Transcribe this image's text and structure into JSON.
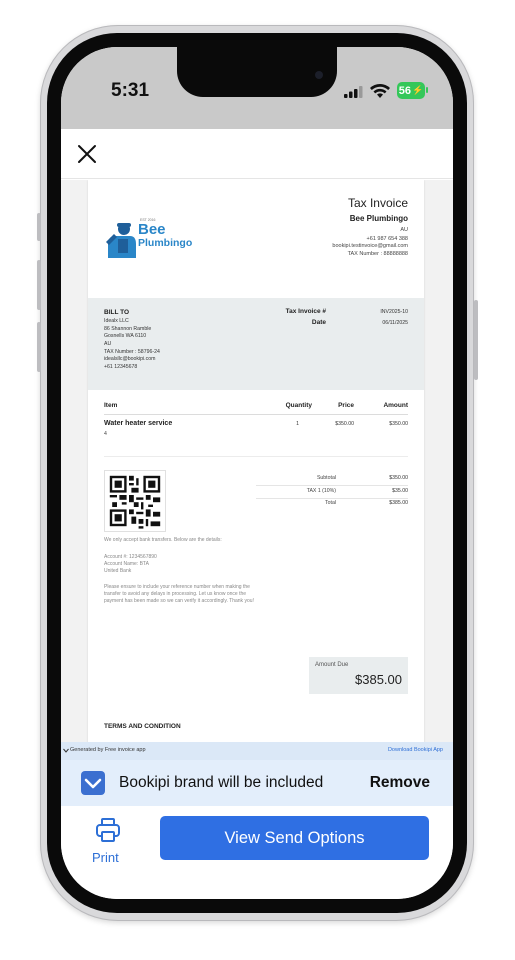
{
  "status_bar": {
    "time": "5:31",
    "battery": "56"
  },
  "invoice": {
    "title": "Tax Invoice",
    "company": "Bee Plumbingo",
    "country": "AU",
    "phone": "+61 987 654 388",
    "email": "bookipi.testinvoice@gmail.com",
    "tax_number": "TAX Number : 88888888",
    "logo": {
      "est": "EST 2016",
      "line1": "Bee",
      "line2": "Plumbingo"
    },
    "bill_to": {
      "label": "BILL TO",
      "lines": [
        "Idealx LLC",
        "86 Shannon Ramble",
        "Gosnells WA 6110",
        "AU",
        "TAX Number : 58796-24",
        "idealsllc@bookipi.com",
        "+61 12345678"
      ]
    },
    "meta": {
      "invoice_label": "Tax Invoice #",
      "invoice_no": "INV2025-10",
      "date_label": "Date",
      "date": "06/11/2025"
    },
    "table": {
      "headers": {
        "item": "Item",
        "quantity": "Quantity",
        "price": "Price",
        "amount": "Amount"
      },
      "rows": [
        {
          "item": "Water heater service",
          "desc": "4",
          "quantity": "1",
          "price": "$350.00",
          "amount": "$350.00"
        }
      ]
    },
    "summary": [
      {
        "label": "Subtotal",
        "value": "$350.00"
      },
      {
        "label": "TAX 1 (10%)",
        "value": "$35.00"
      },
      {
        "label": "Total",
        "value": "$385.00"
      }
    ],
    "payment": {
      "intro": "We only accept bank transfers. Below are the details:",
      "account_no": "Account #: 1234567890",
      "account_name": "Account Name: BTA",
      "bank": "United Bank",
      "note": "Please ensure to include your reference number when making the transfer to avoid any delays in processing. Let us know once the payment has been made so we can verify it accordingly. Thank you!"
    },
    "amount_due": {
      "label": "Amount Due",
      "value": "$385.00"
    },
    "terms_label": "TERMS AND CONDITION"
  },
  "generated_bar": {
    "left": "Generated by Free invoice app",
    "right": "Download Bookipi App"
  },
  "brand_bar": {
    "text": "Bookipi brand will be included",
    "remove": "Remove"
  },
  "bottom": {
    "print": "Print",
    "send": "View Send Options"
  },
  "colors": {
    "accent": "#2f6fe3",
    "brand": "#2a86c8",
    "battery": "#34c759"
  },
  "icons": [
    "close-icon",
    "print-icon",
    "checkmark-icon",
    "chevron-down-icon",
    "wifi-icon",
    "signal-icon",
    "qr-code"
  ]
}
